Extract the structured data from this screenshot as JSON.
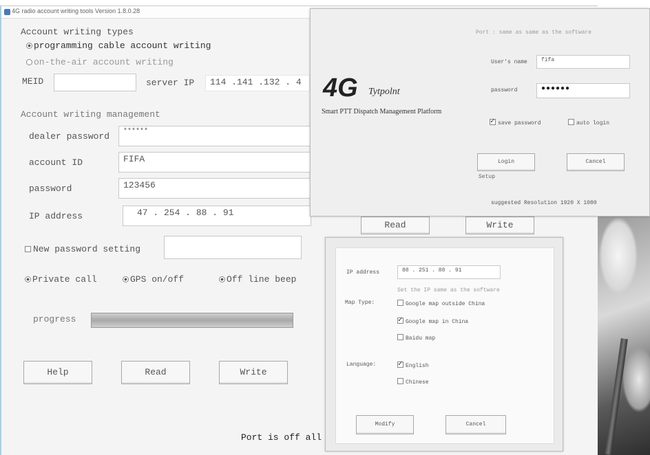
{
  "main": {
    "title": "4G radio account writing tools Version 1.8.0.28",
    "account_writing_types_label": "Account writing types",
    "type_programming": "programming cable account writing",
    "type_ota": "on-the-air account writing",
    "meid_label": "MEID",
    "meid_value": "",
    "server_ip_label": "server IP",
    "server_ip_value": "114 .141 .132 . 4",
    "management_label": "Account writing management",
    "dealer_password_label": "dealer password",
    "dealer_password_value": "******",
    "account_id_label": "account ID",
    "account_id_value": "FIFA",
    "password_label": "password",
    "password_value": "123456",
    "ip_address_label": "IP address",
    "ip_address_value": "47  . 254  . 88  . 91",
    "new_password_label": "New password setting",
    "private_call_label": "Private call",
    "gps_label": "GPS on/off",
    "offline_label": "Off line beep",
    "progress_label": "progress",
    "progress_fraction": 1.0,
    "help_button": "Help",
    "read_button": "Read",
    "write_button": "Write",
    "read_button_2": "Read",
    "write_button_2": "Write",
    "status_text": "Port is off all"
  },
  "login": {
    "top_hint": "Port : same as same as the software",
    "logo_4g": "4G",
    "logo_brand": "Tytpolnt",
    "subtitle": "Smart PTT Dispatch Management Platform",
    "username_label": "User's name",
    "username_value": "fifa",
    "password_label": "password",
    "password_value": "●●●●●●",
    "save_password_label": "save password",
    "auto_login_label": "auto login",
    "login_button": "Login",
    "cancel_button": "Cancel",
    "setup_link": "Setup",
    "resolution_text": "suggested Resolution 1920 X 1080"
  },
  "map_settings": {
    "ip_label": "IP address",
    "ip_value": "88  . 251  .  88  .  91",
    "ip_hint": "Set the IP same as the software",
    "map_type_label": "Map Type:",
    "map_google_outside": "Google map outside China",
    "map_google_china": "Google map in China",
    "map_baidu": "Baidu map",
    "language_label": "Language:",
    "lang_english": "English",
    "lang_chinese": "Chinese",
    "modify_button": "Modify",
    "cancel_button": "Cancel"
  }
}
